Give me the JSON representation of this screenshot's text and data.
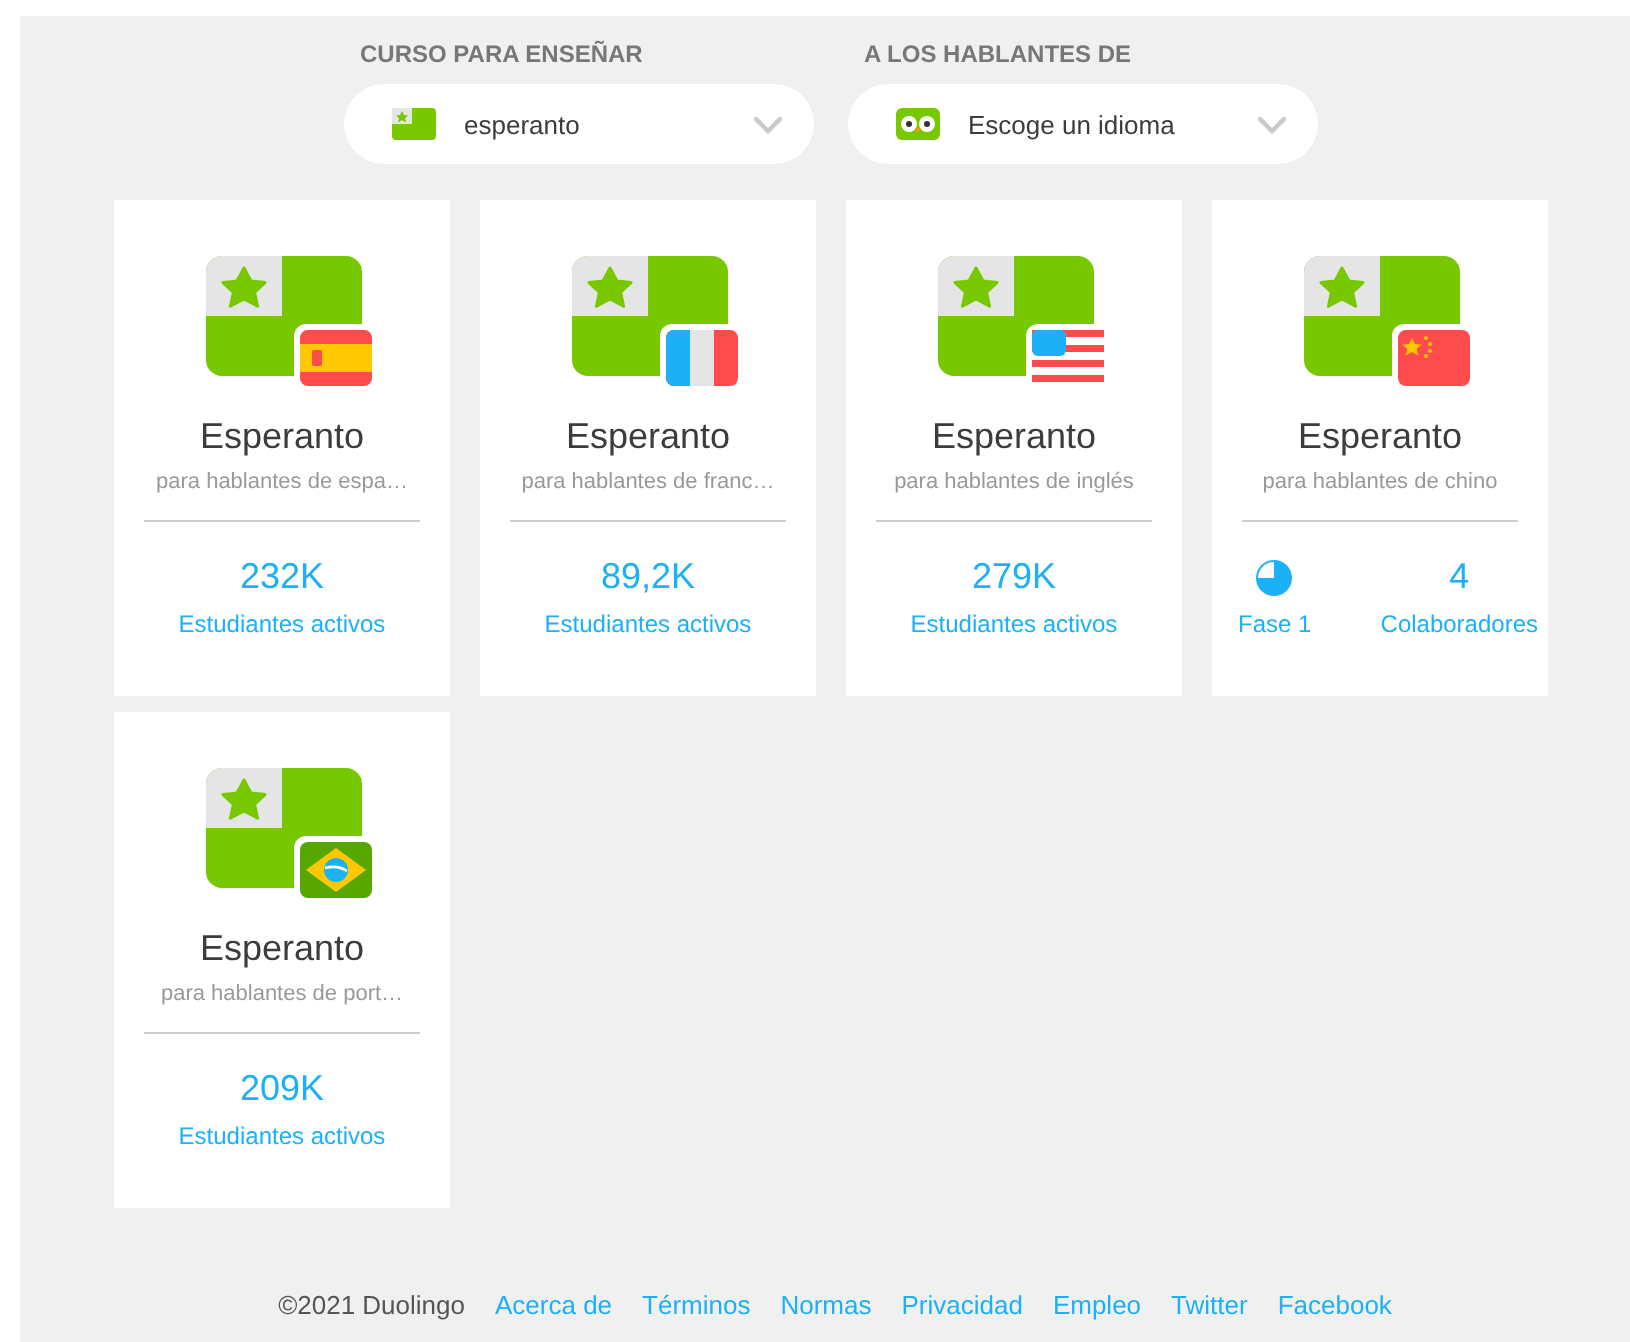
{
  "selectors": [
    {
      "label": "CURSO PARA ENSEÑAR",
      "value": "esperanto"
    },
    {
      "label": "A LOS HABLANTES DE",
      "value": "Escoge un idioma"
    }
  ],
  "courses": [
    {
      "title": "Esperanto",
      "subtitle": "para hablantes de espa…",
      "kind": "stats",
      "count": "232K",
      "count_label": "Estudiantes activos"
    },
    {
      "title": "Esperanto",
      "subtitle": "para hablantes de franc…",
      "kind": "stats",
      "count": "89,2K",
      "count_label": "Estudiantes activos"
    },
    {
      "title": "Esperanto",
      "subtitle": "para hablantes de inglés",
      "kind": "stats",
      "count": "279K",
      "count_label": "Estudiantes activos"
    },
    {
      "title": "Esperanto",
      "subtitle": "para hablantes de chino",
      "kind": "incubator",
      "phase": "Fase 1",
      "count": "4",
      "count_label": "Colaboradores"
    },
    {
      "title": "Esperanto",
      "subtitle": "para hablantes de port…",
      "kind": "stats",
      "count": "209K",
      "count_label": "Estudiantes activos"
    }
  ],
  "footer": {
    "copyright": "©2021 Duolingo",
    "links": [
      "Acerca de",
      "Términos",
      "Normas",
      "Privacidad",
      "Empleo",
      "Twitter",
      "Facebook"
    ]
  }
}
